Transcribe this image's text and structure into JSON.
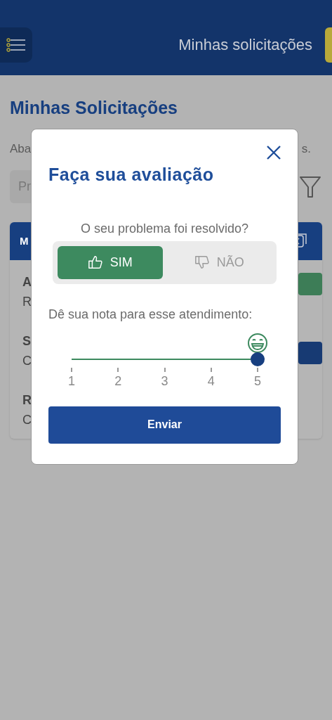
{
  "header": {
    "title": "Minhas solicitações"
  },
  "page": {
    "title": "Minhas Solicitações",
    "intro_start": "Aba",
    "intro_end": "s.",
    "search": {
      "placeholder": "Pr"
    }
  },
  "card": {
    "header": "M",
    "rows": [
      {
        "kind": "success",
        "label": "A",
        "value": "R"
      },
      {
        "kind": "primary",
        "label": "S",
        "value": "C"
      },
      {
        "kind": "plain",
        "label": "R",
        "value": "C"
      }
    ]
  },
  "modal": {
    "title": "Faça sua avaliação",
    "question": "O seu problema foi resolvido?",
    "options": [
      {
        "kind": "yes",
        "label": "SIM",
        "selected": true
      },
      {
        "kind": "no",
        "label": "NÃO",
        "selected": false
      }
    ],
    "rating": {
      "label": "Dê sua nota para esse atendimento:",
      "level": 1,
      "ticks": [
        "1",
        "2",
        "3",
        "4",
        "5"
      ]
    },
    "submit": "Enviar"
  }
}
